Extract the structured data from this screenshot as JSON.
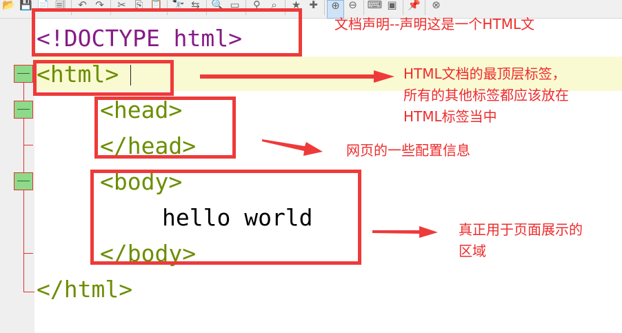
{
  "toolbar": {
    "buttons": [
      {
        "name": "open-folder-icon",
        "glyph": "📂"
      },
      {
        "name": "save-icon",
        "glyph": "💾"
      },
      {
        "name": "new-file-icon",
        "glyph": "📄"
      },
      {
        "name": "copy-file-icon",
        "glyph": "🗐"
      },
      {
        "name": "undo-icon",
        "glyph": "↶"
      },
      {
        "name": "redo-icon",
        "glyph": "↷"
      },
      {
        "name": "cut-icon",
        "glyph": "✂"
      },
      {
        "name": "copy-icon",
        "glyph": "⎘"
      },
      {
        "name": "paste-icon",
        "glyph": "📋"
      },
      {
        "name": "find-icon",
        "glyph": "🔭"
      },
      {
        "name": "replace-icon",
        "glyph": "⇆"
      },
      {
        "name": "search-icon",
        "glyph": "🔍"
      },
      {
        "name": "view-icon",
        "glyph": "▭"
      },
      {
        "name": "tree-icon",
        "glyph": "⚲"
      },
      {
        "name": "zoom-fit-icon",
        "glyph": "⌕"
      },
      {
        "name": "bookmark-icon",
        "glyph": "★"
      },
      {
        "name": "add-bookmark-icon",
        "glyph": "✚"
      },
      {
        "name": "zoom-in-icon",
        "glyph": "⊕"
      },
      {
        "name": "zoom-out-icon",
        "glyph": "⊖"
      },
      {
        "name": "keyboard-icon",
        "glyph": "⌨"
      },
      {
        "name": "terminal-icon",
        "glyph": "▣"
      },
      {
        "name": "pin-icon",
        "glyph": "📌"
      },
      {
        "name": "close-icon",
        "glyph": "⊗"
      }
    ]
  },
  "code": {
    "doctype": "<!DOCTYPE html>",
    "html_open": "<html>",
    "head_open": "<head>",
    "head_close": "</head>",
    "body_open": "<body>",
    "body_text": "hello world",
    "body_close": "</body>",
    "html_close": "</html>"
  },
  "annotations": {
    "doctype_note": "文档声明--声明这是一个HTML文",
    "html_note": "HTML文档的最顶层标签，\n所有的其他标签都应该放在\nHTML标签当中",
    "head_note": "网页的一些配置信息",
    "body_note": "真正用于页面展示的\n区域"
  },
  "colors": {
    "annotation_red": "#ee3a3a",
    "doctype_purple": "#861b86",
    "tag_green": "#6b8e00",
    "current_line": "#fafad2",
    "fold_green": "#8ed98a"
  }
}
